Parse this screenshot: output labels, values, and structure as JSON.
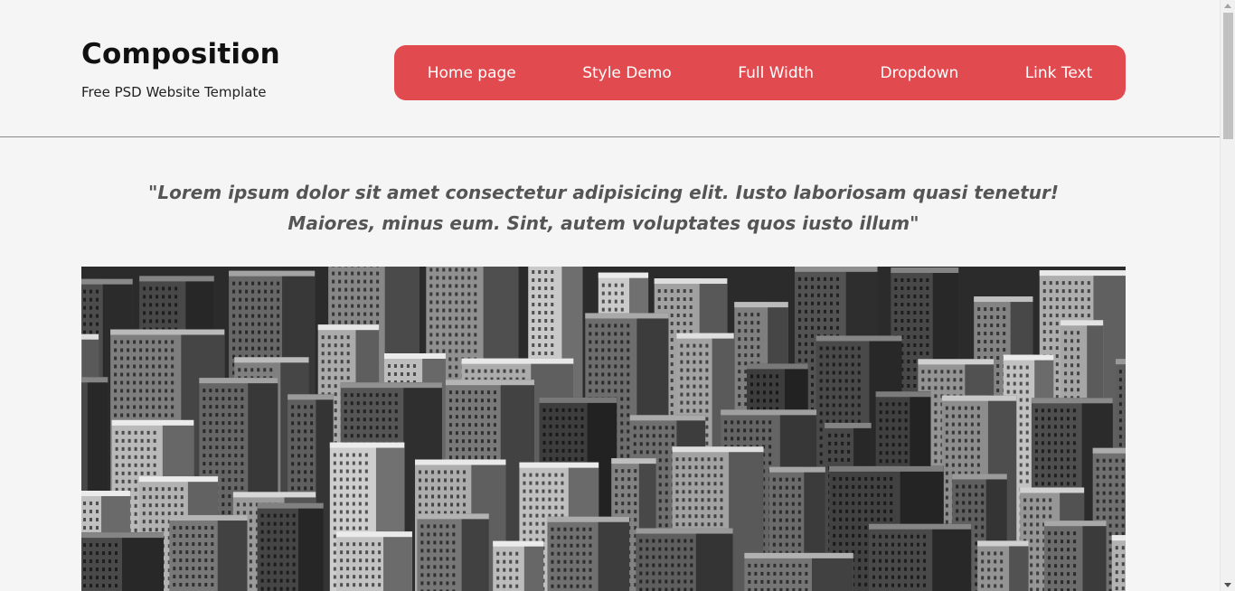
{
  "site": {
    "title": "Composition",
    "subtitle": "Free PSD Website Template"
  },
  "nav": {
    "items": [
      "Home page",
      "Style Demo",
      "Full Width",
      "Dropdown",
      "Link Text"
    ],
    "color": "#e14a4f"
  },
  "quote": {
    "line1": "\"Lorem ipsum dolor sit amet consectetur adipisicing elit. Iusto laboriosam quasi tenetur!",
    "line2": "Maiores, minus eum. Sint, autem voluptates quos iusto illum\""
  },
  "hero": {
    "icon": "city-skyline-photo"
  }
}
